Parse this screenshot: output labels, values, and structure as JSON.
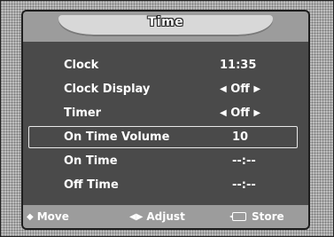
{
  "menu": {
    "title": "Time",
    "rows": [
      {
        "label": "Clock",
        "value": "11:35"
      },
      {
        "label": "Clock Display",
        "left_arrow": "◀",
        "value": "Off",
        "right_arrow": "▶"
      },
      {
        "label": "Timer",
        "left_arrow": "◀",
        "value": "Off",
        "right_arrow": "▶"
      },
      {
        "label": "On Time Volume",
        "value": "10"
      },
      {
        "label": "On Time",
        "value": "--:--"
      },
      {
        "label": "Off Time",
        "value": "--:--"
      }
    ],
    "selected_row": "On Time Volume"
  },
  "footer": {
    "move_icon": "◆",
    "move_label": "Move",
    "adjust_icon": "◀▶",
    "adjust_label": "Adjust",
    "store_label": "Store"
  }
}
